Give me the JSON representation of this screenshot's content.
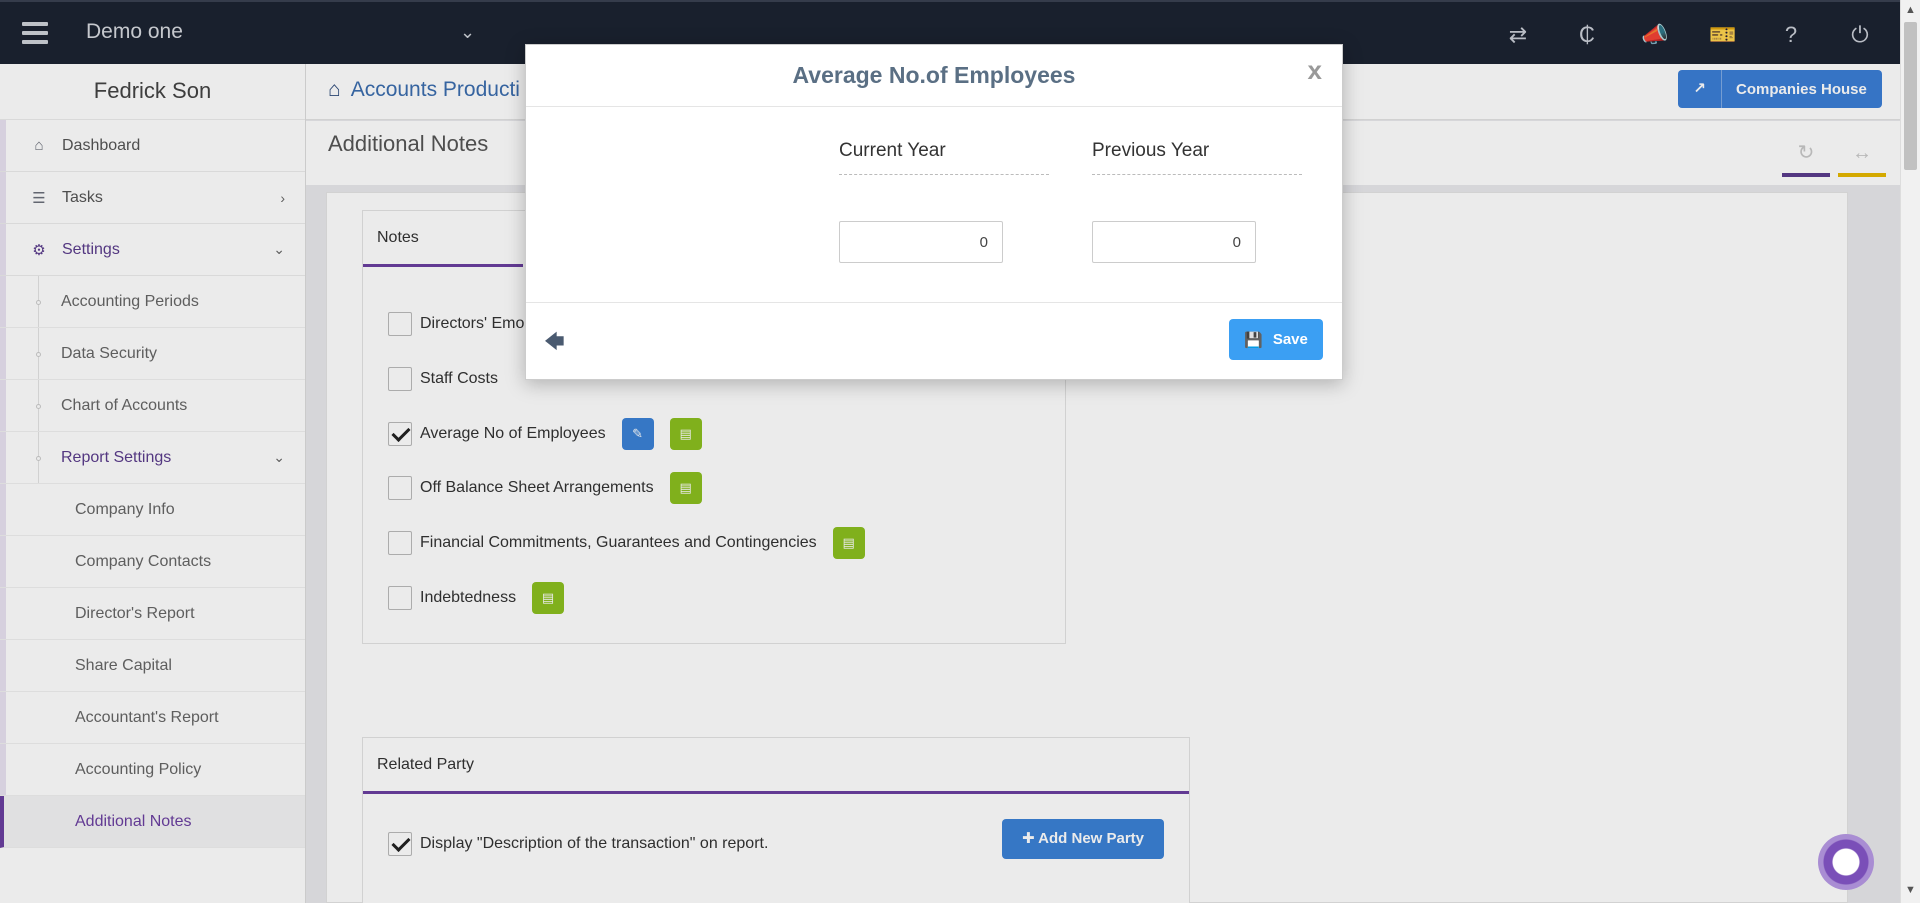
{
  "topbar": {
    "company": "Demo one",
    "icons": [
      "menu-icon",
      "switch-icon",
      "currency-icon",
      "megaphone-icon",
      "ticket-icon",
      "help-icon",
      "power-icon"
    ]
  },
  "sidebar": {
    "user": "Fedrick Son",
    "items": {
      "dashboard": "Dashboard",
      "tasks": "Tasks",
      "settings": "Settings",
      "accounting_periods": "Accounting Periods",
      "data_security": "Data Security",
      "chart_of_accounts": "Chart of Accounts",
      "report_settings": "Report Settings",
      "company_info": "Company Info",
      "company_contacts": "Company Contacts",
      "directors_report": "Director's Report",
      "share_capital": "Share Capital",
      "accountants_report": "Accountant's Report",
      "accounting_policy": "Accounting Policy",
      "additional_notes": "Additional Notes"
    }
  },
  "header": {
    "breadcrumb": "Accounts Producti",
    "companies_house": "Companies House",
    "page_title": "Additional Notes"
  },
  "notes": {
    "title": "Notes",
    "rows": [
      {
        "label": "Directors' Emo",
        "checked": false
      },
      {
        "label": "Staff Costs",
        "checked": false
      },
      {
        "label": "Average No of Employees",
        "checked": true
      },
      {
        "label": "Off Balance Sheet Arrangements",
        "checked": false
      },
      {
        "label": "Financial Commitments, Guarantees and Contingencies",
        "checked": false
      },
      {
        "label": "Indebtedness",
        "checked": false
      }
    ]
  },
  "related_party": {
    "title": "Related Party",
    "display_label": "Display \"Description of the transaction\" on report.",
    "add_button": "Add New Party"
  },
  "modal": {
    "title": "Average No.of Employees",
    "close": "x",
    "current_year_label": "Current Year",
    "previous_year_label": "Previous Year",
    "current_year_value": "0",
    "previous_year_value": "0",
    "save_label": "Save"
  },
  "colors": {
    "topbar": "#1c2331",
    "accent_purple": "#6b3fa0",
    "primary_blue": "#3b82d6",
    "green": "#8bbf1f",
    "save_blue": "#3b9ff3"
  }
}
